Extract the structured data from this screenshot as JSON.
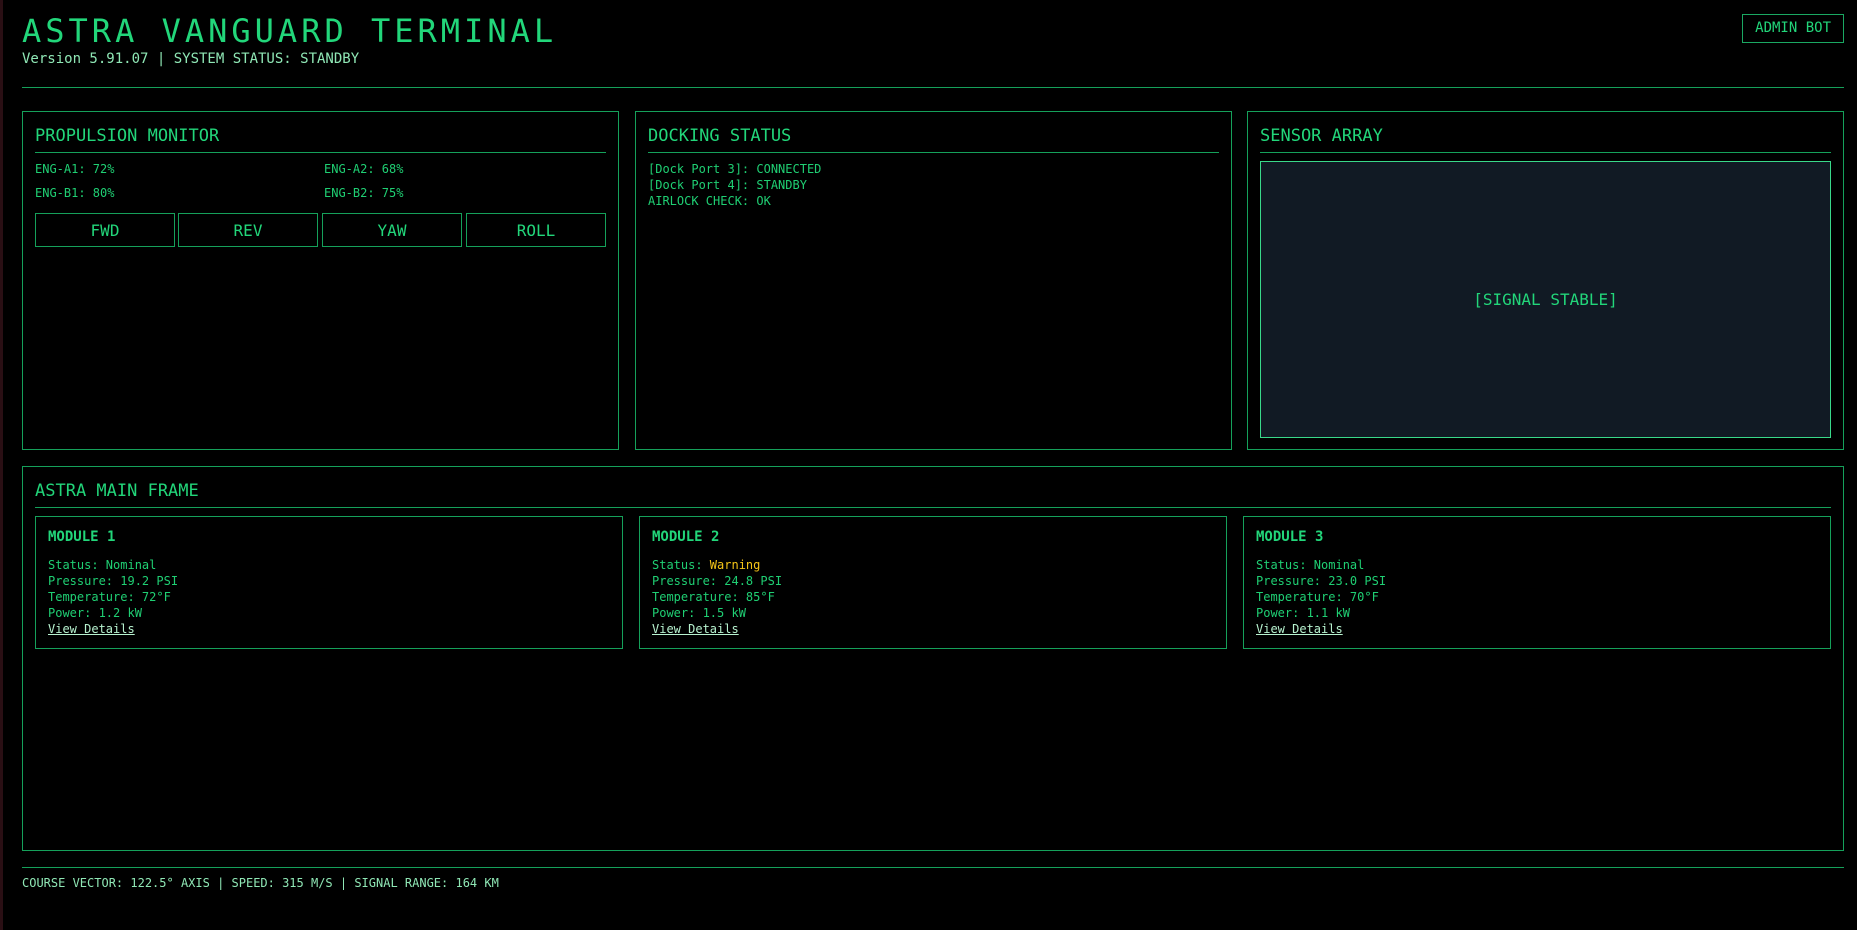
{
  "header": {
    "title": "ASTRA VANGUARD TERMINAL",
    "subtitle": "Version 5.91.07 | SYSTEM STATUS: STANDBY",
    "admin_button": "ADMIN BOT"
  },
  "propulsion": {
    "title": "PROPULSION MONITOR",
    "engines": [
      "ENG-A1: 72%",
      "ENG-A2: 68%",
      "ENG-B1: 80%",
      "ENG-B2: 75%"
    ],
    "controls": [
      "FWD",
      "REV",
      "YAW",
      "ROLL"
    ]
  },
  "docking": {
    "title": "DOCKING STATUS",
    "lines": [
      "[Dock Port 3]: CONNECTED",
      "[Dock Port 4]: STANDBY",
      "AIRLOCK CHECK: OK"
    ]
  },
  "sensor": {
    "title": "SENSOR ARRAY",
    "screen_label": "[SIGNAL STABLE]"
  },
  "mainframe": {
    "title": "ASTRA MAIN FRAME",
    "modules": [
      {
        "name": "MODULE 1",
        "status_label": "Status: ",
        "status_value": "Nominal",
        "pressure": "Pressure: 19.2 PSI",
        "temperature": "Temperature: 72°F",
        "power": "Power: 1.2 kW",
        "link": "View Details"
      },
      {
        "name": "MODULE 2",
        "status_label": "Status: ",
        "status_value": "Warning",
        "pressure": "Pressure: 24.8 PSI",
        "temperature": "Temperature: 85°F",
        "power": "Power: 1.5 kW",
        "link": "View Details"
      },
      {
        "name": "MODULE 3",
        "status_label": "Status: ",
        "status_value": "Nominal",
        "pressure": "Pressure: 23.0 PSI",
        "temperature": "Temperature: 70°F",
        "power": "Power: 1.1 kW",
        "link": "View Details"
      }
    ]
  },
  "footer": {
    "text": "COURSE VECTOR: 122.5° AXIS | SPEED: 315 M/S | SIGNAL RANGE: 164 KM"
  },
  "colors": {
    "background": "#000000",
    "accent": "#22d67a",
    "border": "#15a05a",
    "warning": "#f5c518",
    "sensor_screen": "#111a24"
  }
}
